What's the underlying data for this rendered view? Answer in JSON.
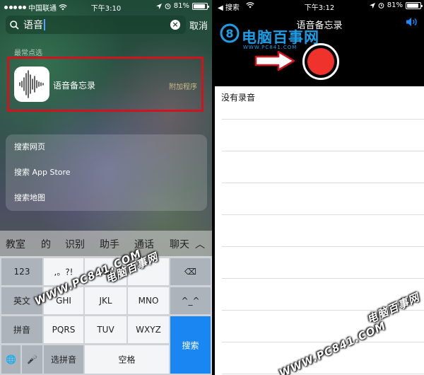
{
  "left": {
    "status": {
      "carrier": "中国联通",
      "time": "下午3:10",
      "battery": "81%",
      "battery_level": 0.81
    },
    "search": {
      "query": "语音",
      "cancel_label": "取消"
    },
    "section_title": "最常点选",
    "top_hit": {
      "name": "语音备忘录",
      "kind": "附加程序"
    },
    "suggestions": [
      "搜索网页",
      "搜索 App Store",
      "搜索地图"
    ],
    "candidates": [
      "教室",
      "的",
      "识别",
      "助手",
      "通话",
      "聊天"
    ],
    "keys": {
      "num": "123",
      "punct": ",。?!",
      "abc": "ABC",
      "backspace": "⌫",
      "english": "英文",
      "ghi": "GHI",
      "jkl": "JKL",
      "mno": "MNO",
      "face": "^_^",
      "pinyin": "拼音",
      "pqrs": "PQRS",
      "tuv": "TUV",
      "wxyz": "WXYZ",
      "search": "搜索",
      "globe": "🌐",
      "mic": "🎤",
      "select_pinyin": "选拼音",
      "space": "空格"
    }
  },
  "right": {
    "status": {
      "back_label": "搜索",
      "time": "下午3:12",
      "battery": "81%",
      "battery_level": 0.81
    },
    "title": "语音备忘录",
    "logo_text": "电脑百事网",
    "logo_sub": "WWW.PC841.COM",
    "empty_text": "没有录音"
  },
  "watermark": {
    "url": "WWW.PC841.COM",
    "name": "电脑百事网"
  },
  "colors": {
    "highlight": "#d0141f",
    "search_key": "#1a86f2",
    "record": "#f0322d",
    "brand": "#1aa0e8"
  }
}
